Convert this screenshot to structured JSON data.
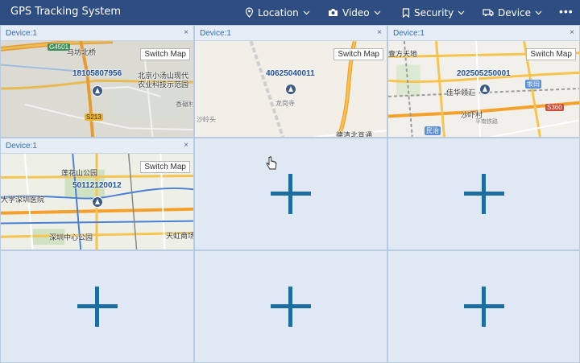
{
  "app": {
    "title": "GPS Tracking System"
  },
  "nav": [
    {
      "label": "Location",
      "icon": "location-pin-icon"
    },
    {
      "label": "Video",
      "icon": "camera-icon"
    },
    {
      "label": "Security",
      "icon": "bookmark-icon"
    },
    {
      "label": "Device",
      "icon": "truck-icon"
    }
  ],
  "more_label": "•••",
  "panels": [
    {
      "header": "Device:1",
      "close": "×",
      "switch_label": "Switch Map",
      "device_id": "18105807956",
      "labels": [
        "马坊北桥",
        "北京小汤山现代",
        "农业科技示范园",
        "香碾村",
        "G4501",
        "S213"
      ]
    },
    {
      "header": "Device:1",
      "close": "×",
      "switch_label": "Switch Map",
      "device_id": "40625040011",
      "labels": [
        "龙岗寺",
        "沙岭头",
        "德清北亘通"
      ]
    },
    {
      "header": "Device:1",
      "close": "×",
      "switch_label": "Switch Map",
      "device_id": "202505250001",
      "labels": [
        "壹方天地",
        "佳华领汇",
        "坂田",
        "沙吓村",
        "民治",
        "S360",
        "平南铁路"
      ]
    },
    {
      "header": "Device:1",
      "close": "×",
      "switch_label": "Switch Map",
      "device_id": "50112120012",
      "labels": [
        "莲花山公园",
        "大学深圳医院",
        "深圳中心公园",
        "天虹商场"
      ]
    }
  ],
  "colors": {
    "topbar": "#2e4d80",
    "add_plus": "#1d6e9e",
    "panel_header_text": "#2f6fb8",
    "cell_bg": "#dfe8f3"
  }
}
